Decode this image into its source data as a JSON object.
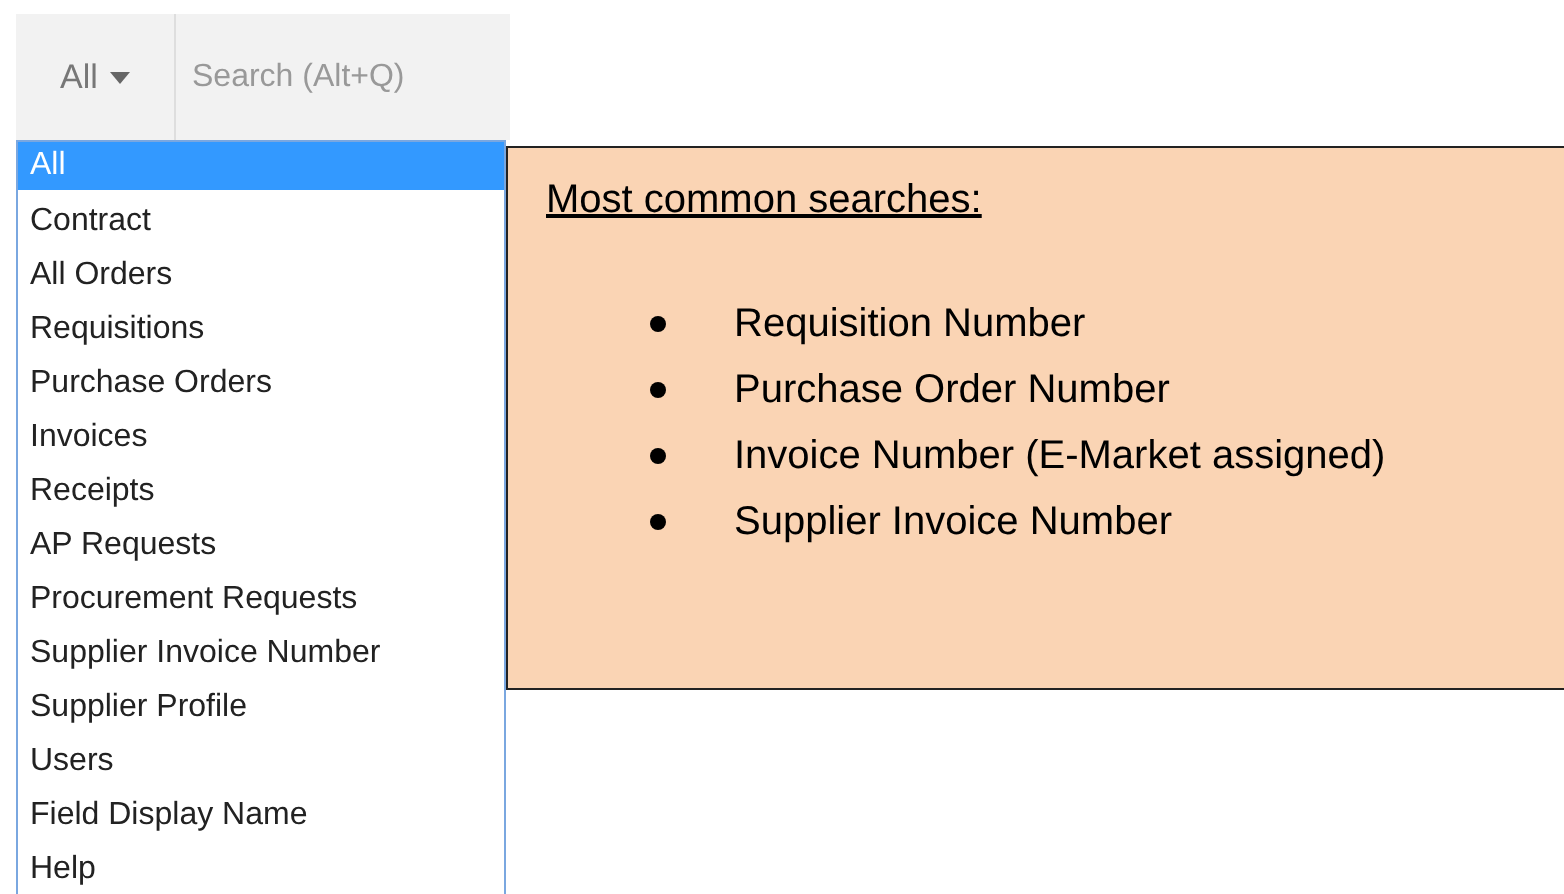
{
  "search_bar": {
    "scope": "All",
    "placeholder": "Search (Alt+Q)"
  },
  "dropdown": {
    "items": [
      {
        "label": "All",
        "selected": true
      },
      {
        "label": "Contract",
        "selected": false
      },
      {
        "label": "All Orders",
        "selected": false
      },
      {
        "label": "Requisitions",
        "selected": false
      },
      {
        "label": "Purchase Orders",
        "selected": false
      },
      {
        "label": "Invoices",
        "selected": false
      },
      {
        "label": "Receipts",
        "selected": false
      },
      {
        "label": "AP Requests",
        "selected": false
      },
      {
        "label": "Procurement Requests",
        "selected": false
      },
      {
        "label": "Supplier Invoice Number",
        "selected": false
      },
      {
        "label": "Supplier Profile",
        "selected": false
      },
      {
        "label": "Users",
        "selected": false
      },
      {
        "label": "Field Display Name",
        "selected": false
      },
      {
        "label": "Help",
        "selected": false
      }
    ]
  },
  "callout": {
    "title": "Most common searches:",
    "items": [
      "Requisition Number",
      "Purchase Order Number",
      "Invoice Number (E-Market assigned)",
      "Supplier Invoice Number"
    ]
  }
}
